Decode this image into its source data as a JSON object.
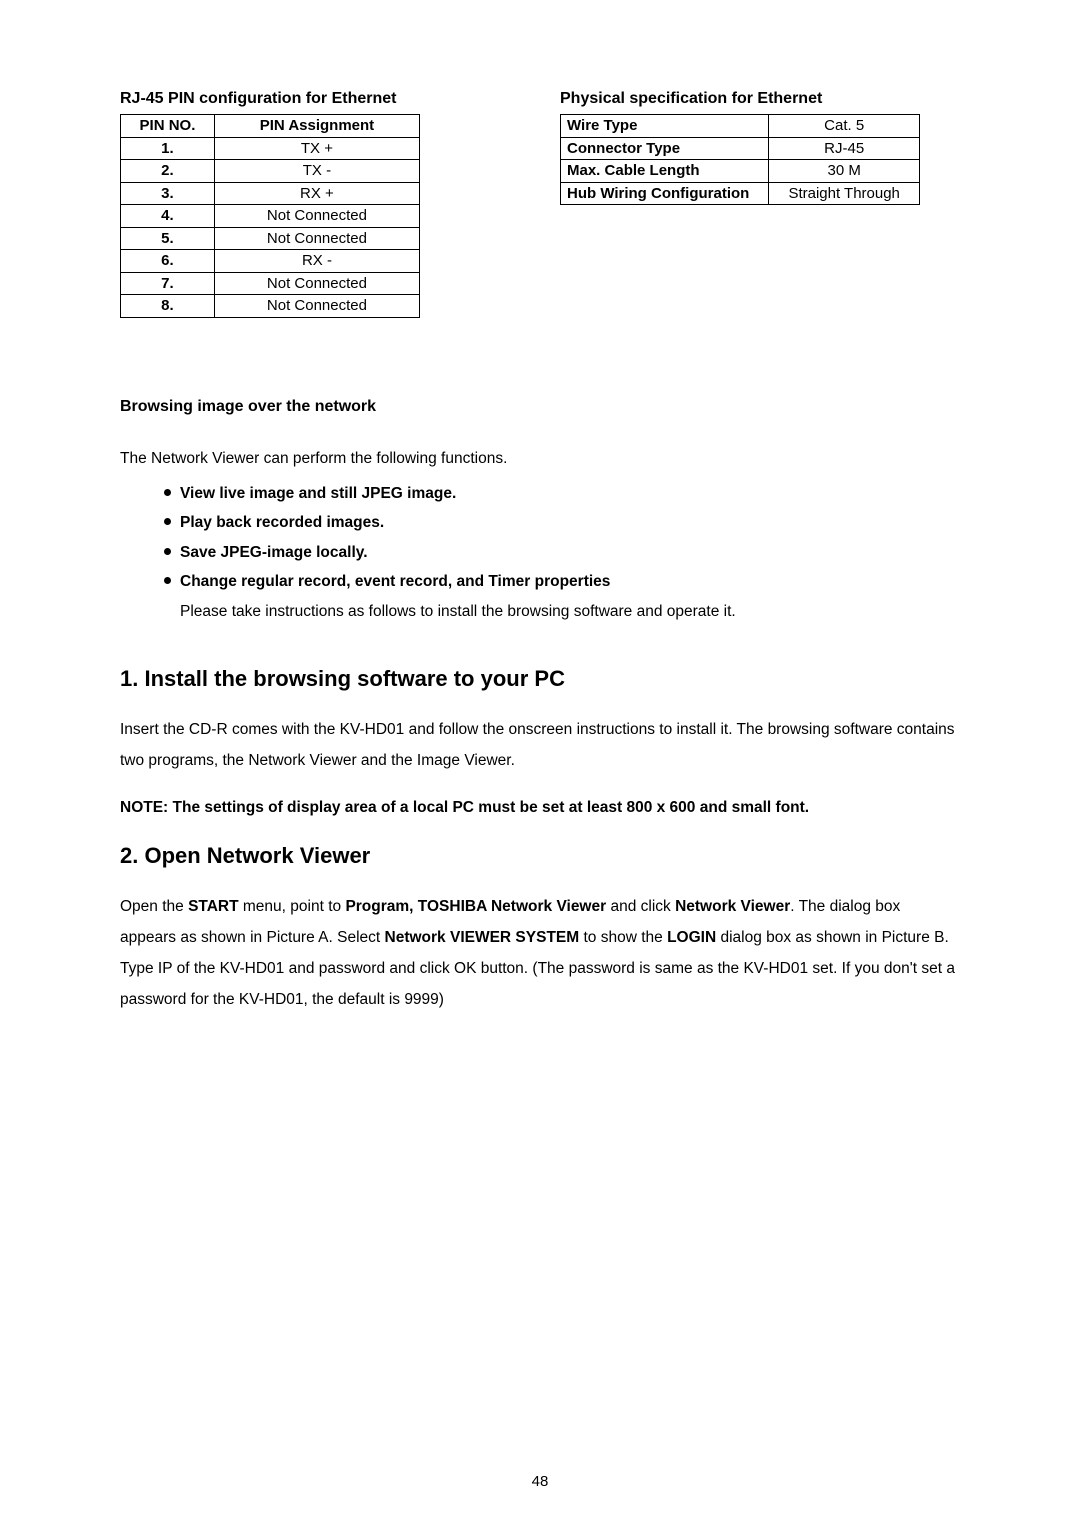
{
  "chart_data": [
    {
      "type": "table",
      "title": "RJ-45 PIN configuration for Ethernet",
      "columns": [
        "PIN NO.",
        "PIN Assignment"
      ],
      "rows": [
        [
          "1.",
          "TX +"
        ],
        [
          "2.",
          "TX -"
        ],
        [
          "3.",
          "RX +"
        ],
        [
          "4.",
          "Not Connected"
        ],
        [
          "5.",
          "Not Connected"
        ],
        [
          "6.",
          "RX -"
        ],
        [
          "7.",
          "Not Connected"
        ],
        [
          "8.",
          "Not Connected"
        ]
      ]
    },
    {
      "type": "table",
      "title": "Physical specification for Ethernet",
      "rows": [
        [
          "Wire Type",
          "Cat. 5"
        ],
        [
          "Connector Type",
          "RJ-45"
        ],
        [
          "Max. Cable Length",
          "30 M"
        ],
        [
          "Hub Wiring Configuration",
          "Straight Through"
        ]
      ]
    }
  ],
  "tables": {
    "pin": {
      "title": "RJ-45 PIN configuration for Ethernet",
      "head1": "PIN NO.",
      "head2": "PIN Assignment",
      "rows": [
        {
          "no": "1.",
          "val": "TX +"
        },
        {
          "no": "2.",
          "val": "TX -"
        },
        {
          "no": "3.",
          "val": "RX +"
        },
        {
          "no": "4.",
          "val": "Not Connected"
        },
        {
          "no": "5.",
          "val": "Not Connected"
        },
        {
          "no": "6.",
          "val": "RX -"
        },
        {
          "no": "7.",
          "val": "Not Connected"
        },
        {
          "no": "8.",
          "val": "Not Connected"
        }
      ]
    },
    "spec": {
      "title": "Physical specification for Ethernet",
      "rows": [
        {
          "k": "Wire Type",
          "v": "Cat. 5"
        },
        {
          "k": "Connector Type",
          "v": "RJ-45"
        },
        {
          "k": "Max. Cable Length",
          "v": "30 M"
        },
        {
          "k": "Hub Wiring Configuration",
          "v": "Straight Through"
        }
      ]
    }
  },
  "section1": {
    "title": "Browsing image over the network",
    "intro": "The Network Viewer can perform the following functions.",
    "bullets": [
      "View live image and still JPEG image.",
      "Play back recorded images.",
      "Save JPEG-image locally.",
      "Change regular record, event record, and Timer properties"
    ],
    "sub": "Please take instructions as follows to install the browsing software and operate it."
  },
  "h2_1": "1. Install the browsing software to your PC",
  "p1a": "Insert the CD-R comes with the KV-HD01 and follow the onscreen instructions to install it. The browsing software contains two programs, the Network Viewer and the Image Viewer.",
  "note": "NOTE: The settings of display area of a local PC must be set at least 800 x 600 and small font.",
  "h2_2": "2. Open Network Viewer",
  "p2": {
    "t1": "Open the ",
    "b1": "START",
    "t2": " menu, point to ",
    "b2": "Program, TOSHIBA Network Viewer",
    "t3": " and click ",
    "b3": "Network Viewer",
    "t4": ".",
    "line2a": "The dialog box appears as shown in Picture A. Select ",
    "b4": "Network VIEWER SYSTEM",
    "line2b": " to show the ",
    "b5": "LOGIN",
    "line3": " dialog box as shown in Picture B. Type IP of the KV-HD01 and password and click OK button. (The password is same as the KV-HD01 set. If you don't set a password for the KV-HD01, the default is 9999)"
  },
  "page_number": "48"
}
